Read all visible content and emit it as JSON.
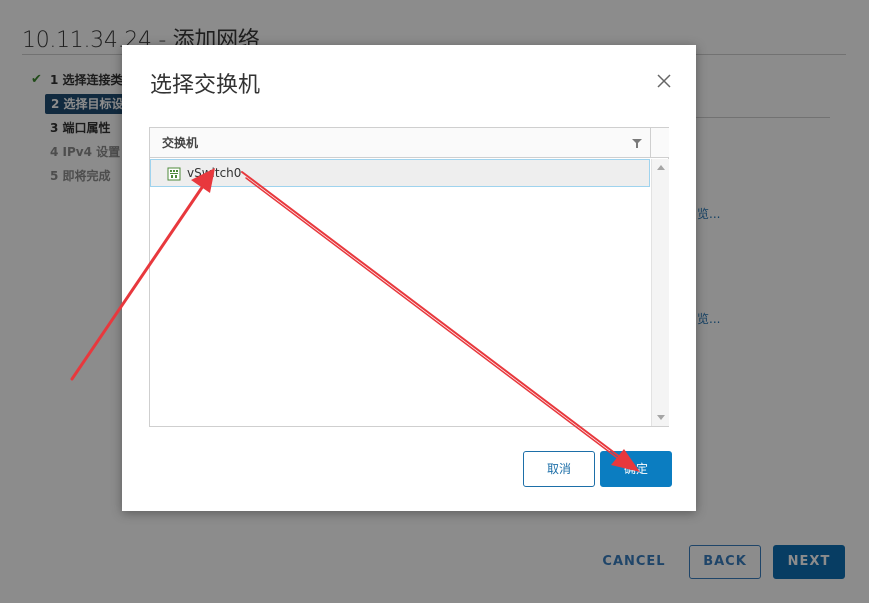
{
  "wizard": {
    "title": "10.11.34.24 - 添加网络",
    "steps": [
      {
        "label": "1 选择连接类",
        "state": "done"
      },
      {
        "label": "2 选择目标设",
        "state": "active"
      },
      {
        "label": "3 端口属性",
        "state": "plain"
      },
      {
        "label": "4 IPv4 设置",
        "state": "pending"
      },
      {
        "label": "5 即将完成",
        "state": "pending"
      }
    ],
    "browse_link_1": "览...",
    "browse_link_2": "览...",
    "footer": {
      "cancel": "CANCEL",
      "back": "BACK",
      "next": "NEXT"
    }
  },
  "dialog": {
    "title": "选择交换机",
    "grid": {
      "column_header": "交换机",
      "rows": [
        {
          "name": "vSwitch0",
          "icon": "virtual-switch-icon",
          "selected": true
        }
      ]
    },
    "buttons": {
      "cancel": "取消",
      "ok": "确定"
    }
  },
  "colors": {
    "accent": "#0b7dc1",
    "active_step": "#1f4d73",
    "selection_border": "#9fd3ee",
    "annotation_arrow": "#e8383d"
  }
}
